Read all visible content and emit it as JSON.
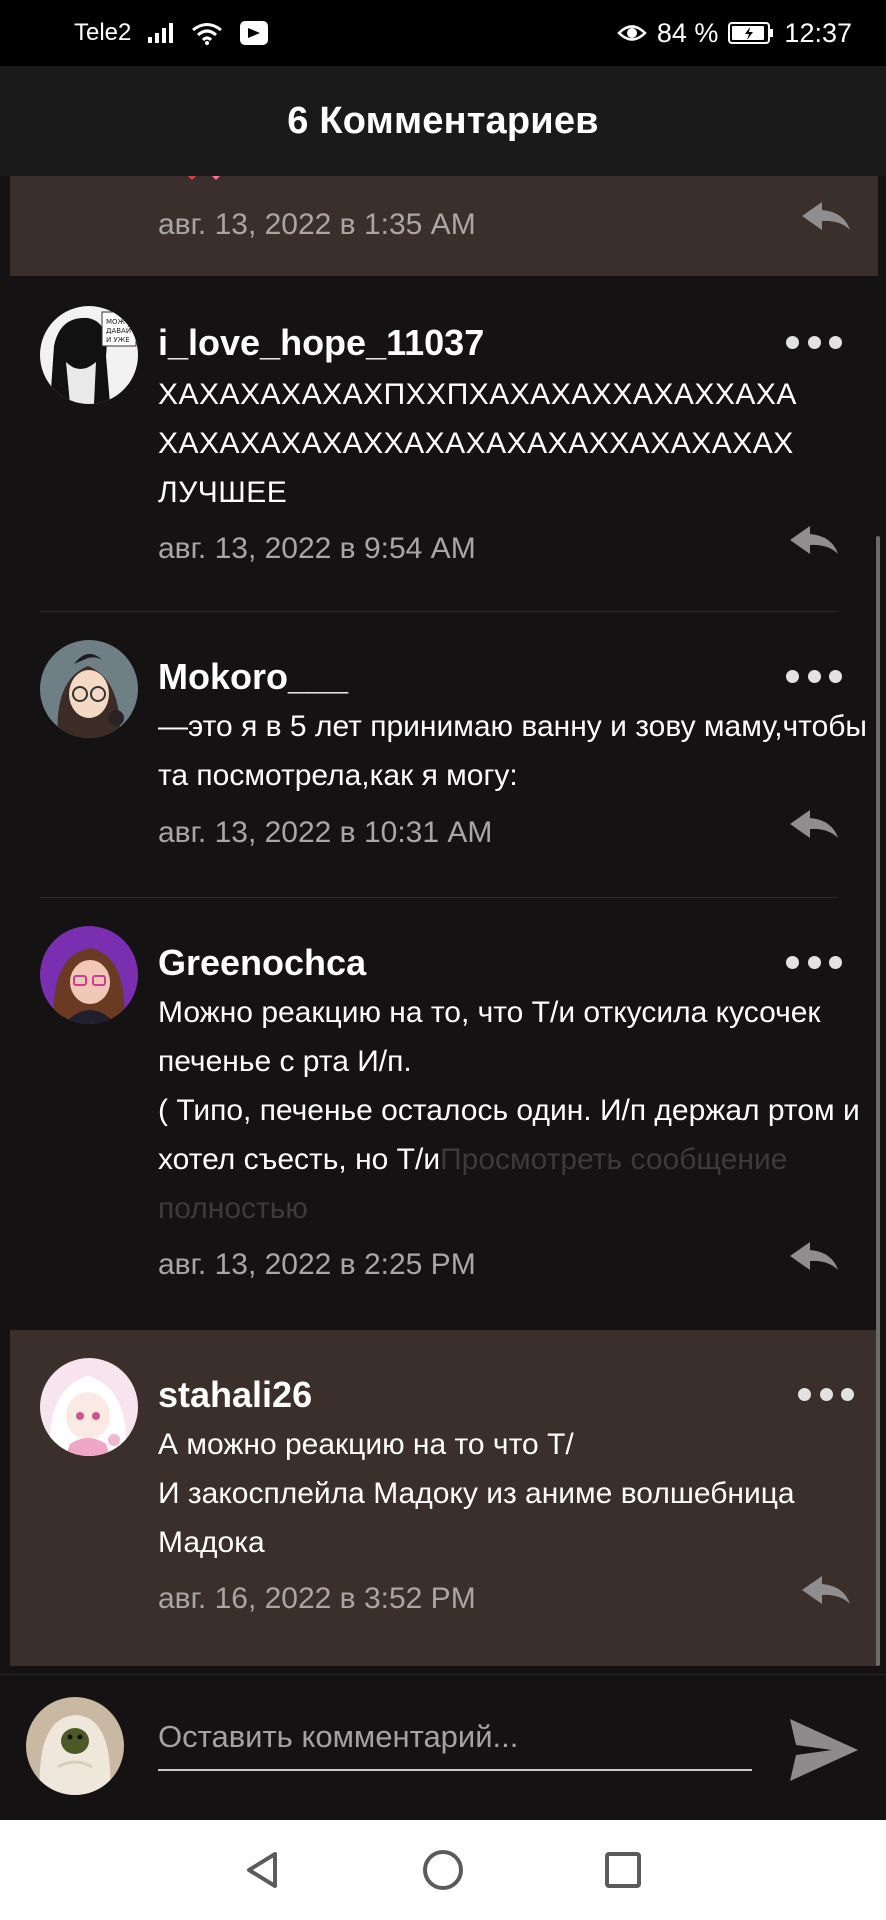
{
  "status_bar": {
    "carrier": "Tele2",
    "battery": "84 %",
    "time": "12:37"
  },
  "header": {
    "title": "6 Комментариев"
  },
  "comments": [
    {
      "username": "",
      "text": "",
      "timestamp": "авг. 13, 2022 в 1:35 AM",
      "highlighted": true
    },
    {
      "username": "i_love_hope_11037",
      "text": "ХАХАХАХАХАХПХХПХАХАХАХХАХАХХАХА ХАХАХАХАХАХХАХАХАХАХАХХАХАХАХАХ ЛУЧШЕЕ",
      "timestamp": "авг. 13, 2022 в 9:54 AM"
    },
    {
      "username": "Mokoro___",
      "text": "—это я в 5 лет принимаю ванну и зову маму,чтобы та посмотрела,как я могу:",
      "timestamp": "авг. 13, 2022 в 10:31 AM"
    },
    {
      "username": "Greenochca",
      "text": "Можно реакцию на то, что Т/и откусила кусочек печенье с рта И/п.\n( Типо, печенье осталось один. И/п держал ртом и хотел съесть, но Т/и",
      "more_label": "Просмотреть сообщение полностью",
      "timestamp": "авг. 13, 2022 в 2:25 PM"
    },
    {
      "username": "stahali26",
      "text": "А можно реакцию на то что Т/\nИ закосплейла Мадоку из аниме волшебница Мадока",
      "timestamp": "авг. 16, 2022 в 3:52 PM",
      "highlighted": true
    }
  ],
  "input": {
    "placeholder": "Оставить комментарий..."
  },
  "icons": {
    "more": "more-dots-icon",
    "reply": "reply-arrow-icon",
    "send": "send-icon",
    "nav": [
      "back-triangle-icon",
      "home-circle-icon",
      "recents-square-icon"
    ]
  },
  "colors": {
    "background": "#151214",
    "highlight": "#3a2f2b",
    "header": "#1b1a1b",
    "timestamp": "#a8a6a7"
  }
}
